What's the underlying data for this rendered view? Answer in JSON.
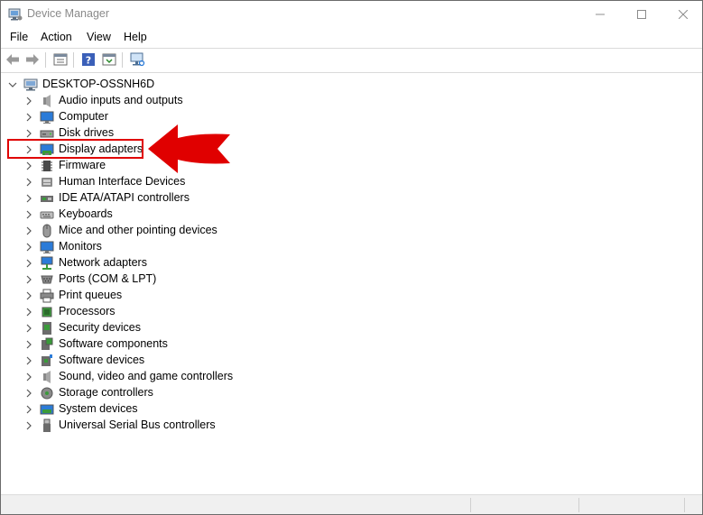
{
  "window": {
    "title": "Device Manager",
    "controls": {
      "minimize": "─",
      "maximize": "☐",
      "close": "✕"
    }
  },
  "menu": [
    "File",
    "Action",
    "View",
    "Help"
  ],
  "toolbar": {
    "buttons": [
      "back-icon",
      "forward-icon",
      "properties-icon",
      "help-icon",
      "update-driver-icon",
      "scan-hardware-icon"
    ]
  },
  "tree": {
    "root": "DESKTOP-OSSNH6D",
    "categories": [
      "Audio inputs and outputs",
      "Computer",
      "Disk drives",
      "Display adapters",
      "Firmware",
      "Human Interface Devices",
      "IDE ATA/ATAPI controllers",
      "Keyboards",
      "Mice and other pointing devices",
      "Monitors",
      "Network adapters",
      "Ports (COM & LPT)",
      "Print queues",
      "Processors",
      "Security devices",
      "Software components",
      "Software devices",
      "Sound, video and game controllers",
      "Storage controllers",
      "System devices",
      "Universal Serial Bus controllers"
    ],
    "highlighted": "Display adapters"
  },
  "colors": {
    "annotation_red": "#e00000",
    "monitor_blue": "#2b7bd8"
  }
}
